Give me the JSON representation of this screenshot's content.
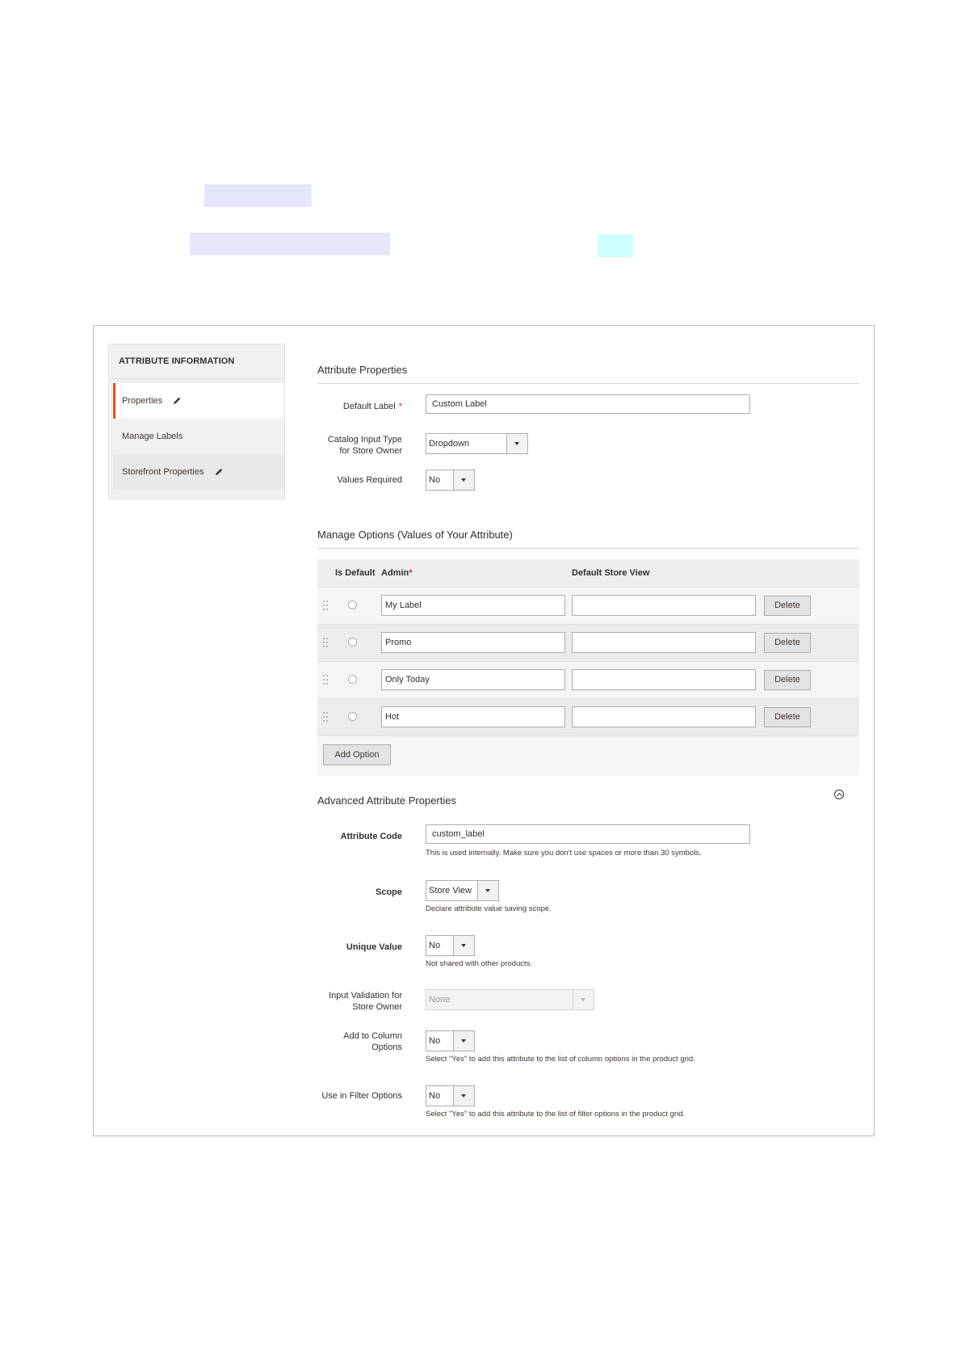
{
  "sidebar": {
    "title": "ATTRIBUTE INFORMATION",
    "items": [
      {
        "label": "Properties",
        "icon": "pencil-icon"
      },
      {
        "label": "Manage Labels"
      },
      {
        "label": "Storefront Properties",
        "icon": "pencil-icon"
      }
    ]
  },
  "attribute_properties": {
    "title": "Attribute Properties",
    "default_label": {
      "label": "Default Label",
      "required_mark": "*",
      "value": "Custom Label"
    },
    "input_type": {
      "label_line1": "Catalog Input Type",
      "label_line2": "for Store Owner",
      "value": "Dropdown"
    },
    "values_required": {
      "label": "Values Required",
      "value": "No"
    }
  },
  "manage_options": {
    "title": "Manage Options (Values of Your Attribute)",
    "col_is_default": "Is Default",
    "col_admin": "Admin",
    "col_admin_required": "*",
    "col_store_view": "Default Store View",
    "rows": [
      {
        "admin": "My Label",
        "store_view": "",
        "delete_label": "Delete"
      },
      {
        "admin": "Promo",
        "store_view": "",
        "delete_label": "Delete"
      },
      {
        "admin": "Only Today",
        "store_view": "",
        "delete_label": "Delete"
      },
      {
        "admin": "Hot",
        "store_view": "",
        "delete_label": "Delete"
      }
    ],
    "add_option_label": "Add Option"
  },
  "advanced": {
    "title": "Advanced Attribute Properties",
    "attribute_code": {
      "label": "Attribute Code",
      "value": "custom_label",
      "note": "This is used internally. Make sure you don't use spaces or more than 30 symbols."
    },
    "scope": {
      "label": "Scope",
      "value": "Store View",
      "note": "Declare attribute value saving scope."
    },
    "unique_value": {
      "label": "Unique Value",
      "value": "No",
      "note": "Not shared with other products."
    },
    "input_validation": {
      "label_line1": "Input Validation for",
      "label_line2": "Store Owner",
      "value": "None"
    },
    "add_to_column": {
      "label_line1": "Add to Column",
      "label_line2": "Options",
      "value": "No",
      "note": "Select \"Yes\" to add this attribute to the list of column options in the product grid."
    },
    "filter_options": {
      "label": "Use in Filter Options",
      "value": "No",
      "note": "Select \"Yes\" to add this attribute to the list of filter options in the product grid."
    }
  },
  "colors": {
    "accent": "#eb5202",
    "required": "#e22626",
    "border": "#adadad"
  }
}
